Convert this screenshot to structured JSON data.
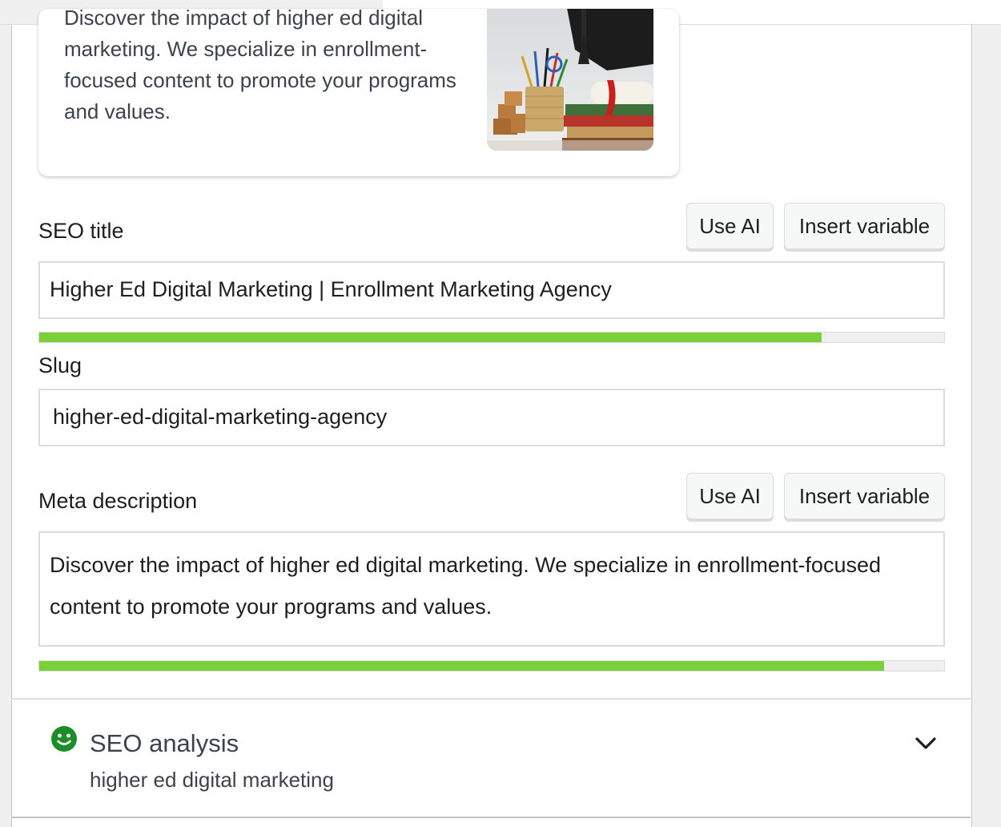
{
  "preview": {
    "description": "Discover the impact of higher ed digital marketing. We specialize in enrollment-focused content to promote your programs and values.",
    "image_alt": "graduation cap, diploma, books and pencils"
  },
  "seo_title": {
    "label": "SEO title",
    "use_ai_label": "Use AI",
    "insert_variable_label": "Insert variable",
    "value": "Higher Ed Digital Marketing | Enrollment Marketing Agency",
    "progress": 0.865,
    "progress_color": "#7ad03a"
  },
  "slug": {
    "label": "Slug",
    "value": "higher-ed-digital-marketing-agency"
  },
  "meta_description": {
    "label": "Meta description",
    "use_ai_label": "Use AI",
    "insert_variable_label": "Insert variable",
    "value": "Discover the impact of higher ed digital marketing. We specialize in enrollment-focused content to promote your programs and values.",
    "progress": 0.934,
    "progress_color": "#7ad03a"
  },
  "seo_analysis": {
    "title": "SEO analysis",
    "keyphrase": "higher ed digital marketing",
    "status_color": "#1e8c29",
    "status_icon": "smiley-face-icon",
    "toggle_icon": "chevron-down-icon"
  }
}
